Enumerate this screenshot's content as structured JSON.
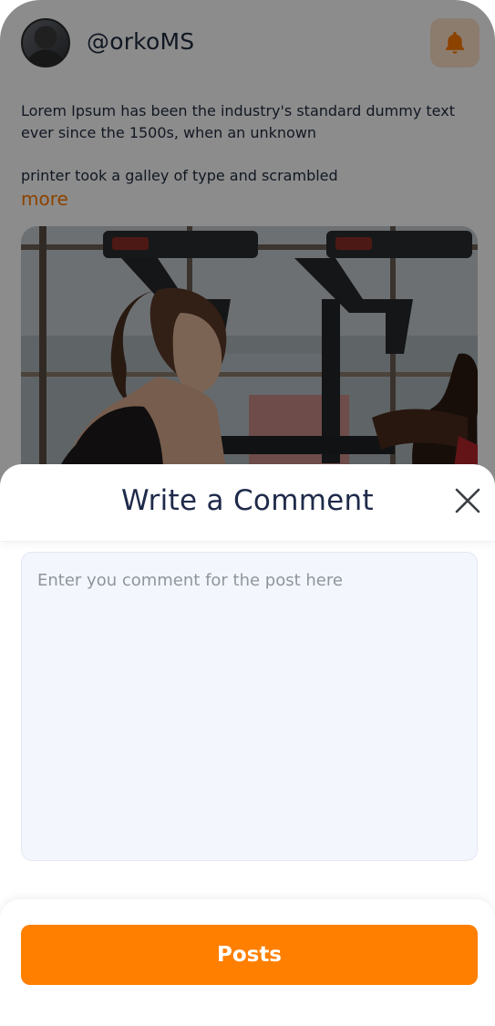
{
  "profile": {
    "username": "@orkoMS"
  },
  "post": {
    "text_line1": "Lorem Ipsum has been the industry's standard dummy text",
    "text_line2": "ever since the 1500s, when an unknown",
    "text_line3": "printer took a galley of type and scrambled",
    "more_label": "more"
  },
  "icons": {
    "notification": "bell-icon",
    "close": "close-icon"
  },
  "comment_sheet": {
    "title": "Write a Comment",
    "input_placeholder": "Enter you comment for the post here",
    "input_value": "",
    "submit_label": "Posts"
  },
  "colors": {
    "accent": "#ff7f00",
    "text_dark": "#1f2a4a",
    "input_bg": "#f3f6fc"
  }
}
